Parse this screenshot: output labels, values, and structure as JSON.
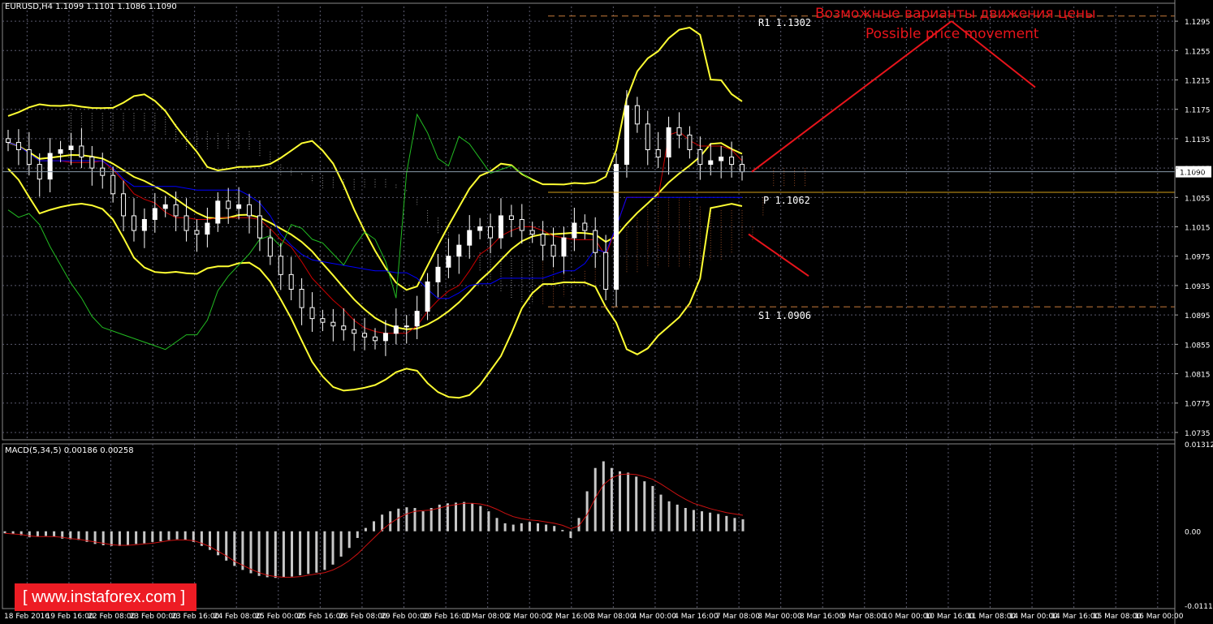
{
  "header": {
    "symbol_info": "EURUSD,H4  1.1099 1.1101 1.1086 1.1090",
    "indicator_label": "MACD(5,34,5) 0.00186 0.00258"
  },
  "annotations": {
    "forecast_ru": "Возможные варианты движения цены",
    "forecast_en": "Possible price movement",
    "r1": "R1 1.1302",
    "pivot": "P 1.1062",
    "s1": "S1 1.0906"
  },
  "watermark": {
    "text": "[ www.instaforex.com ]"
  },
  "colors": {
    "background": "#000000",
    "candle": "#ffffff",
    "bollinger": "#ffff33",
    "forecast": "#e8141b",
    "kijun": "#0000ff",
    "tenkan": "#cc0000",
    "chikou": "#22bb22",
    "grid": "#5a5a6e",
    "pivot_line": "#d4a017",
    "current_price": "#8a9aaa"
  },
  "chart_data": [
    {
      "type": "line",
      "name": "price",
      "price_axis": [
        "1.1295",
        "1.1255",
        "1.1215",
        "1.1175",
        "1.1135",
        "1.1095",
        "1.1055",
        "1.1015",
        "1.0975",
        "1.0935",
        "1.0895",
        "1.0855",
        "1.0815",
        "1.0775",
        "1.0735"
      ],
      "current_price": "1.1090",
      "ylim": [
        1.0725,
        1.1315
      ],
      "time_axis": [
        "18 Feb 2016",
        "19 Feb 16:00",
        "22 Feb 08:00",
        "23 Feb 00:00",
        "23 Feb 16:00",
        "24 Feb 08:00",
        "25 Feb 00:00",
        "25 Feb 16:00",
        "26 Feb 08:00",
        "29 Feb 00:00",
        "29 Feb 16:00",
        "1 Mar 08:00",
        "2 Mar 00:00",
        "2 Mar 16:00",
        "3 Mar 08:00",
        "4 Mar 00:00",
        "4 Mar 16:00",
        "7 Mar 08:00",
        "8 Mar 00:00",
        "8 Mar 16:00",
        "9 Mar 08:00",
        "10 Mar 00:00",
        "10 Mar 16:00",
        "11 Mar 08:00",
        "14 Mar 00:00",
        "14 Mar 16:00",
        "15 Mar 08:00",
        "16 Mar 00:00"
      ],
      "close": [
        1.113,
        1.112,
        1.11,
        1.108,
        1.1115,
        1.112,
        1.1125,
        1.111,
        1.1095,
        1.1085,
        1.106,
        1.103,
        1.101,
        1.1025,
        1.104,
        1.1045,
        1.103,
        1.101,
        1.1005,
        1.102,
        1.105,
        1.104,
        1.1045,
        1.103,
        1.1,
        1.0975,
        1.095,
        1.093,
        1.0905,
        1.089,
        1.0885,
        1.088,
        1.0875,
        1.087,
        1.0865,
        1.086,
        1.087,
        1.088,
        1.088,
        1.09,
        1.094,
        1.096,
        1.0975,
        1.099,
        1.101,
        1.1015,
        1.1,
        1.103,
        1.1025,
        1.101,
        1.1005,
        1.099,
        1.0975,
        1.1,
        1.102,
        1.101,
        1.098,
        1.093,
        1.11,
        1.118,
        1.1155,
        1.112,
        1.111,
        1.115,
        1.114,
        1.112,
        1.11,
        1.1105,
        1.111,
        1.11,
        1.109
      ],
      "levels": {
        "R1": 1.1302,
        "P": 1.1062,
        "S1": 1.0906
      }
    },
    {
      "type": "bar",
      "name": "MACD(5,34,5)",
      "macd_axis": [
        "0.01312",
        "0.00",
        "-0.0111"
      ],
      "ylim": [
        -0.0116,
        0.01312
      ],
      "values": [
        -0.0003,
        -0.0004,
        -0.0006,
        -0.0009,
        -0.0008,
        -0.0007,
        -0.0008,
        -0.0011,
        -0.0012,
        -0.0013,
        -0.0016,
        -0.0019,
        -0.0021,
        -0.0022,
        -0.0022,
        -0.0021,
        -0.0019,
        -0.0018,
        -0.0016,
        -0.0015,
        -0.0013,
        -0.0012,
        -0.0013,
        -0.0016,
        -0.0022,
        -0.0028,
        -0.0036,
        -0.0044,
        -0.0052,
        -0.0058,
        -0.0063,
        -0.0067,
        -0.0069,
        -0.007,
        -0.0069,
        -0.0068,
        -0.0066,
        -0.0064,
        -0.0062,
        -0.0058,
        -0.005,
        -0.0038,
        -0.0025,
        -0.001,
        0.0005,
        0.0015,
        0.0025,
        0.003,
        0.0034,
        0.0036,
        0.0035,
        0.003,
        0.0035,
        0.004,
        0.0042,
        0.0043,
        0.0044,
        0.0042,
        0.0038,
        0.003,
        0.002,
        0.0012,
        0.001,
        0.0012,
        0.0014,
        0.0012,
        0.001,
        0.0008,
        0.0002,
        -0.001,
        0.002,
        0.006,
        0.0095,
        0.0105,
        0.0095,
        0.009,
        0.0088,
        0.0082,
        0.0075,
        0.0068,
        0.0055,
        0.0045,
        0.004,
        0.0035,
        0.0032,
        0.003,
        0.0028,
        0.0026,
        0.0023,
        0.002,
        0.0018
      ],
      "signal": [
        -0.0003,
        -0.0004,
        -0.0005,
        -0.0007,
        -0.0008,
        -0.0008,
        -0.0008,
        -0.0009,
        -0.0011,
        -0.0012,
        -0.0014,
        -0.0016,
        -0.0018,
        -0.002,
        -0.0021,
        -0.0021,
        -0.002,
        -0.0019,
        -0.0018,
        -0.0016,
        -0.0014,
        -0.0013,
        -0.0013,
        -0.0014,
        -0.0018,
        -0.0023,
        -0.003,
        -0.0037,
        -0.0045,
        -0.0051,
        -0.0057,
        -0.0062,
        -0.0066,
        -0.0068,
        -0.0069,
        -0.0069,
        -0.0068,
        -0.0066,
        -0.0064,
        -0.0062,
        -0.0058,
        -0.0052,
        -0.0044,
        -0.0034,
        -0.0022,
        -0.001,
        0.0002,
        0.0012,
        0.002,
        0.0026,
        0.003,
        0.0031,
        0.0032,
        0.0035,
        0.0038,
        0.004,
        0.0042,
        0.0042,
        0.0041,
        0.0038,
        0.0033,
        0.0027,
        0.0022,
        0.0019,
        0.0017,
        0.0016,
        0.0014,
        0.0012,
        0.0009,
        0.0004,
        0.0008,
        0.0025,
        0.005,
        0.007,
        0.008,
        0.0085,
        0.0086,
        0.0085,
        0.0082,
        0.0078,
        0.0071,
        0.0063,
        0.0055,
        0.0048,
        0.0042,
        0.0038,
        0.0034,
        0.0031,
        0.0028,
        0.0026,
        0.0024
      ]
    }
  ]
}
